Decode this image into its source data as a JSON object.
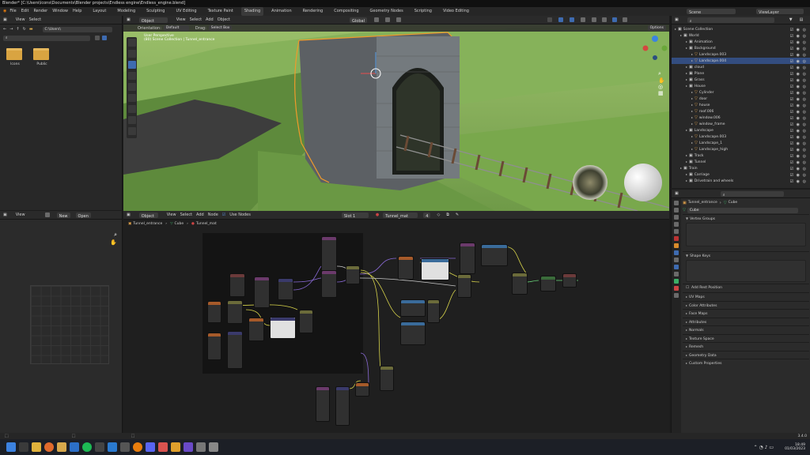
{
  "window": {
    "title": "Blender* [C:\\Users\\lcons\\Documents\\Blender projects\\Endless engine\\Endless_engine.blend]"
  },
  "menu": {
    "items": [
      "File",
      "Edit",
      "Render",
      "Window",
      "Help"
    ],
    "workspaces": [
      "Layout",
      "Modeling",
      "Sculpting",
      "UV Editing",
      "Texture Paint",
      "Shading",
      "Animation",
      "Rendering",
      "Compositing",
      "Geometry Nodes",
      "Scripting",
      "Video Editing"
    ],
    "active_workspace": "Shading",
    "scene": "Scene",
    "view_layer": "ViewLayer"
  },
  "file_browser": {
    "menu": [
      "View",
      "Select"
    ],
    "path": "C:\\Users\\",
    "folders": [
      {
        "name": "lcons"
      },
      {
        "name": "Public"
      }
    ]
  },
  "viewport": {
    "mode": "Object Mode",
    "menu": [
      "View",
      "Select",
      "Add",
      "Object"
    ],
    "orientation_label": "Orientation:",
    "orientation": "Default",
    "drag_label": "Drag:",
    "drag": "Select Box",
    "transform": "Global",
    "options": "Options",
    "overlay_title": "User Perspective",
    "overlay_sub": "(80) Scene Collection | Tunnel_entrance"
  },
  "outliner": {
    "items": [
      {
        "label": "Scene Collection",
        "depth": 0
      },
      {
        "label": "World",
        "depth": 1
      },
      {
        "label": "Animation",
        "depth": 2
      },
      {
        "label": "Background",
        "depth": 2
      },
      {
        "label": "Landscape.003",
        "depth": 3
      },
      {
        "label": "Landscape.004",
        "depth": 3,
        "selected": true
      },
      {
        "label": "cloud",
        "depth": 2
      },
      {
        "label": "Plane",
        "depth": 2
      },
      {
        "label": "Grass",
        "depth": 2
      },
      {
        "label": "House",
        "depth": 2
      },
      {
        "label": "Cylinder",
        "depth": 3
      },
      {
        "label": "door",
        "depth": 3
      },
      {
        "label": "house",
        "depth": 3
      },
      {
        "label": "roof.006",
        "depth": 3
      },
      {
        "label": "window.006",
        "depth": 3
      },
      {
        "label": "window_frame",
        "depth": 3
      },
      {
        "label": "Landscape",
        "depth": 2
      },
      {
        "label": "Landscape.003",
        "depth": 3
      },
      {
        "label": "Landscape_1",
        "depth": 3
      },
      {
        "label": "Landscape_high",
        "depth": 3
      },
      {
        "label": "Track",
        "depth": 2
      },
      {
        "label": "Tunnel",
        "depth": 2
      },
      {
        "label": "Train",
        "depth": 1
      },
      {
        "label": "Carriage",
        "depth": 2
      },
      {
        "label": "Drivetrain and wheels",
        "depth": 2
      }
    ]
  },
  "properties": {
    "breadcrumb_object": "Tunnel_entrance",
    "breadcrumb_data": "Cube",
    "data_name": "Cube",
    "sections": {
      "vertex_groups": "Vertex Groups",
      "shape_keys": "Shape Keys",
      "add_rest": "Add Rest Position"
    },
    "collapsed": [
      "UV Maps",
      "Color Attributes",
      "Face Maps",
      "Attributes",
      "Normals",
      "Texture Space",
      "Remesh",
      "Geometry Data",
      "Custom Properties"
    ]
  },
  "uv_editor": {
    "menu": [
      "View"
    ],
    "buttons": [
      "New",
      "Open"
    ]
  },
  "node_editor": {
    "type": "Object",
    "menu": [
      "View",
      "Select",
      "Add",
      "Node"
    ],
    "use_nodes": "Use Nodes",
    "slot": "Slot 1",
    "material": "Tunnel_mat",
    "users": "4",
    "breadcrumb": [
      "Tunnel_entrance",
      "Cube",
      "Tunnel_mat"
    ]
  },
  "status": {
    "version": "3.4.0"
  },
  "taskbar": {
    "time": "18:49",
    "date": "01/03/2023"
  }
}
